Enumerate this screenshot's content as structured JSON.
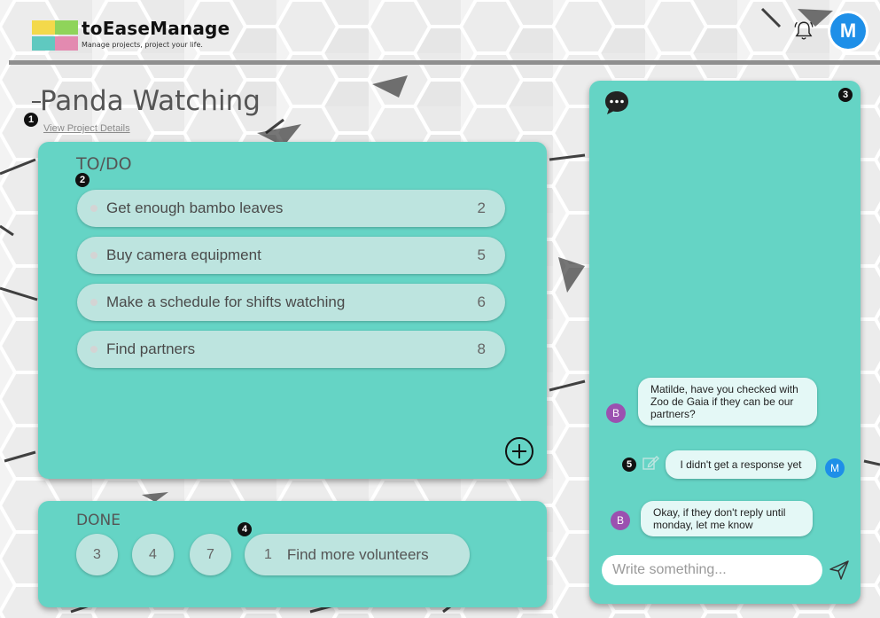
{
  "app": {
    "name": "toEaseManage",
    "tagline": "Manage projects, project your life.",
    "user_initial": "M"
  },
  "icons": {
    "notification": "bell-icon",
    "chat": "chat-bubble-icon",
    "add": "plus-circle-icon",
    "edit": "edit-icon",
    "send": "send-icon"
  },
  "colors": {
    "panel": "#65d4c5",
    "item": "#bde4df",
    "accent_blue": "#1e8fe8",
    "accent_purple": "#9b51b0"
  },
  "project": {
    "title": "Panda Watching",
    "details_link": "View Project Details"
  },
  "markers": [
    "1",
    "2",
    "3",
    "4",
    "5"
  ],
  "todo": {
    "heading": "TO/DO",
    "items": [
      {
        "label": "Get enough bambo leaves",
        "number": "2"
      },
      {
        "label": "Buy camera equipment",
        "number": "5"
      },
      {
        "label": "Make a schedule for shifts watching",
        "number": "6"
      },
      {
        "label": "Find partners",
        "number": "8"
      }
    ]
  },
  "done": {
    "heading": "DONE",
    "chips": [
      "3",
      "4",
      "7"
    ],
    "expanded": {
      "number": "1",
      "label": "Find more volunteers"
    }
  },
  "chat": {
    "messages": [
      {
        "avatar": "B",
        "text": "Matilde, have you checked with Zoo de Gaia if they can be our partners?"
      },
      {
        "avatar": "M",
        "text": "I didn't get a response yet"
      },
      {
        "avatar": "B",
        "text": "Okay, if they don't reply until monday, let me know"
      }
    ],
    "input_placeholder": "Write something..."
  }
}
